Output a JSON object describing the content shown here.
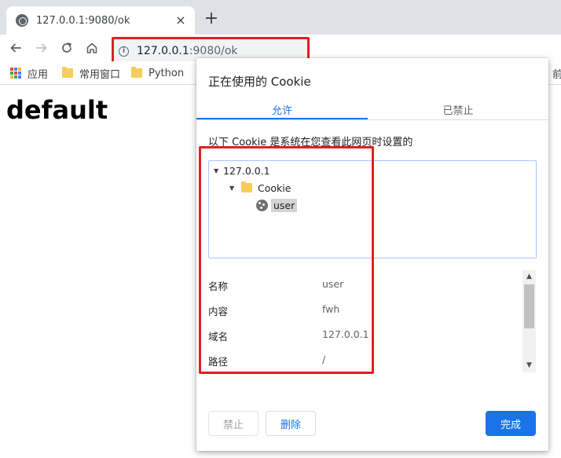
{
  "browser": {
    "tab_title": "127.0.0.1:9080/ok",
    "tab_close": "×",
    "new_tab": "+",
    "url_host": "127.0.0.1",
    "url_rest": ":9080/ok",
    "bookmarks": [
      {
        "label": "应用",
        "icon": "apps-icon"
      },
      {
        "label": "常用窗口",
        "icon": "folder-icon"
      },
      {
        "label": "Python",
        "icon": "folder-icon"
      },
      {
        "label": "前",
        "icon": "folder-icon"
      }
    ]
  },
  "page": {
    "heading": "default"
  },
  "dialog": {
    "title": "正在使用的 Cookie",
    "tabs": [
      {
        "label": "允许",
        "active": true
      },
      {
        "label": "已禁止",
        "active": false
      }
    ],
    "description": "以下 Cookie 是系统在您查看此网页时设置的",
    "tree": {
      "site": "127.0.0.1",
      "folder": "Cookie",
      "cookie": "user"
    },
    "properties": [
      {
        "key": "名称",
        "value": "user"
      },
      {
        "key": "内容",
        "value": "fwh"
      },
      {
        "key": "域名",
        "value": "127.0.0.1"
      },
      {
        "key": "路径",
        "value": "/"
      }
    ],
    "buttons": {
      "block": "禁止",
      "delete": "删除",
      "done": "完成"
    }
  },
  "colors": {
    "accent": "#1a73e8",
    "annotation": "#e02020",
    "folder": "#f6cd5c"
  }
}
